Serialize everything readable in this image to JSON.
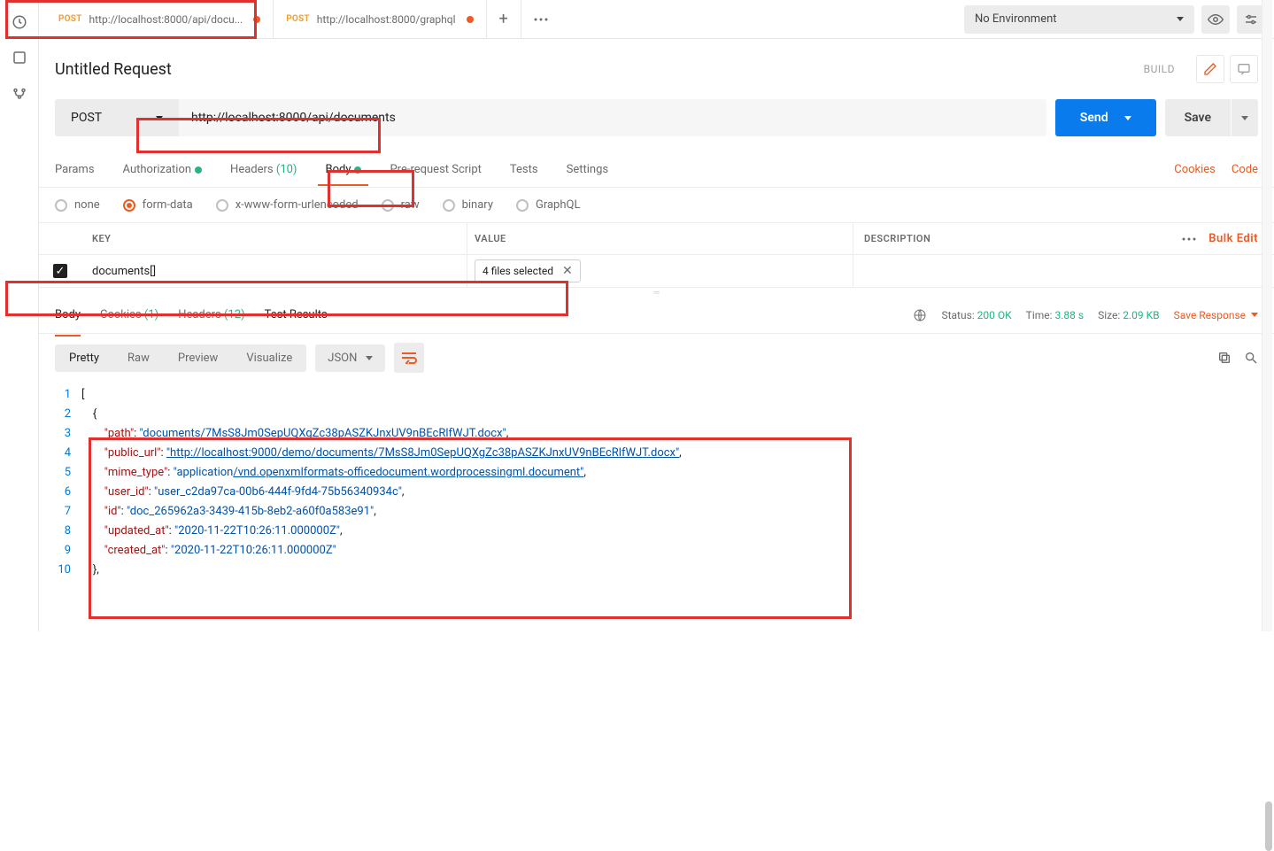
{
  "sidebar": {
    "icons": [
      "history",
      "collections",
      "apis"
    ]
  },
  "tabs": [
    {
      "method": "POST",
      "label": "http://localhost:8000/api/docu...",
      "dirty": true
    },
    {
      "method": "POST",
      "label": "http://localhost:8000/graphql",
      "dirty": true
    }
  ],
  "env": {
    "label": "No Environment"
  },
  "request": {
    "title": "Untitled Request",
    "build_label": "BUILD",
    "method": "POST",
    "url": "http://localhost:8000/api/documents",
    "send_label": "Send",
    "save_label": "Save"
  },
  "req_tabs": {
    "params": "Params",
    "auth": "Authorization",
    "headers": "Headers",
    "headers_count": "(10)",
    "body": "Body",
    "prereq": "Pre-request Script",
    "tests": "Tests",
    "settings": "Settings",
    "cookies_link": "Cookies",
    "code_link": "Code"
  },
  "body_types": {
    "none": "none",
    "form": "form-data",
    "urlenc": "x-www-form-urlencoded",
    "raw": "raw",
    "binary": "binary",
    "graphql": "GraphQL",
    "selected": "form"
  },
  "form_table": {
    "key_header": "KEY",
    "value_header": "VALUE",
    "desc_header": "DESCRIPTION",
    "bulk_edit": "Bulk Edit",
    "rows": [
      {
        "key": "documents[]",
        "value_label": "4 files selected"
      }
    ]
  },
  "response": {
    "tabs": {
      "body": "Body",
      "cookies": "Cookies",
      "cookies_count": "(1)",
      "headers": "Headers",
      "headers_count": "(12)",
      "test": "Test Results"
    },
    "status_label": "Status:",
    "status_val": "200 OK",
    "time_label": "Time:",
    "time_val": "3.88 s",
    "size_label": "Size:",
    "size_val": "2.09 KB",
    "save_resp": "Save Response"
  },
  "view": {
    "pretty": "Pretty",
    "raw": "Raw",
    "preview": "Preview",
    "visualize": "Visualize",
    "lang": "JSON"
  },
  "code_lines": [
    {
      "n": 1,
      "t": "[",
      "cls": "pun",
      "ind": 0
    },
    {
      "n": 2,
      "t": "{",
      "cls": "pun",
      "ind": 1
    },
    {
      "n": 3,
      "k": "\"path\"",
      "v": "\"documents/7MsS8Jm0SepUQXgZc38pASZKJnxUV9nBEcRlfWJT.docx\"",
      "end": ",",
      "link_from": 10
    },
    {
      "n": 4,
      "k": "\"public_url\"",
      "v": "\"http://localhost:9000/demo/documents/7MsS8Jm0SepUQXgZc38pASZKJnxUV9nBEcRlfWJT.docx\"",
      "end": ",",
      "link_all": true
    },
    {
      "n": 5,
      "k": "\"mime_type\"",
      "v": "\"application/vnd.openxmlformats-officedocument.wordprocessingml.document\"",
      "end": ",",
      "link_from": 12
    },
    {
      "n": 6,
      "k": "\"user_id\"",
      "v": "\"user_c2da97ca-00b6-444f-9fd4-75b56340934c\"",
      "end": ","
    },
    {
      "n": 7,
      "k": "\"id\"",
      "v": "\"doc_265962a3-3439-415b-8eb2-a60f0a583e91\"",
      "end": ","
    },
    {
      "n": 8,
      "k": "\"updated_at\"",
      "v": "\"2020-11-22T10:26:11.000000Z\"",
      "end": ","
    },
    {
      "n": 9,
      "k": "\"created_at\"",
      "v": "\"2020-11-22T10:26:11.000000Z\"",
      "end": ""
    },
    {
      "n": 10,
      "t": "},",
      "cls": "pun",
      "ind": 1
    }
  ]
}
